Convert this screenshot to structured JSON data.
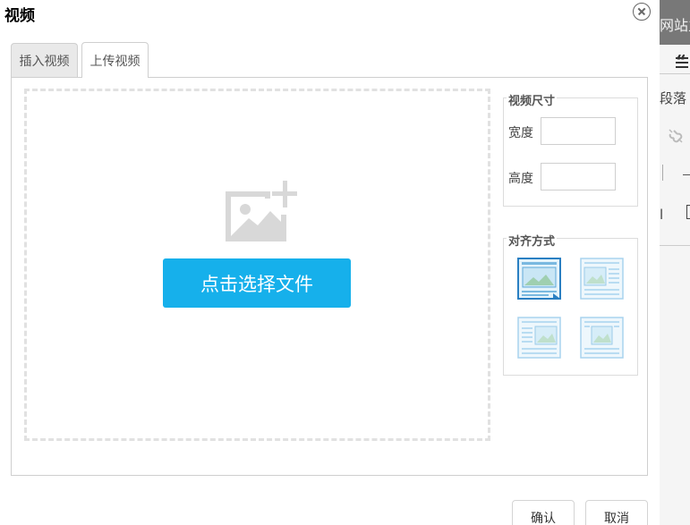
{
  "dialog": {
    "title": "视频",
    "close_icon": "close-circle-icon"
  },
  "tabs": [
    {
      "label": "插入视频",
      "active": false
    },
    {
      "label": "上传视频",
      "active": true
    }
  ],
  "upload": {
    "placeholder_icon": "image-add-icon",
    "select_button": "点击选择文件"
  },
  "video_size": {
    "legend": "视频尺寸",
    "width_label": "宽度",
    "width_value": "",
    "height_label": "高度",
    "height_value": ""
  },
  "alignment": {
    "legend": "对齐方式",
    "options": [
      {
        "name": "none",
        "selected": true
      },
      {
        "name": "left",
        "selected": false
      },
      {
        "name": "right",
        "selected": false
      },
      {
        "name": "center",
        "selected": false
      }
    ]
  },
  "footer": {
    "ok": "确认",
    "cancel": "取消"
  },
  "background": {
    "top_bar_text": "网站主",
    "paragraph": "段落"
  },
  "colors": {
    "accent": "#16b0eb",
    "selected_border": "#2a7fc2"
  }
}
